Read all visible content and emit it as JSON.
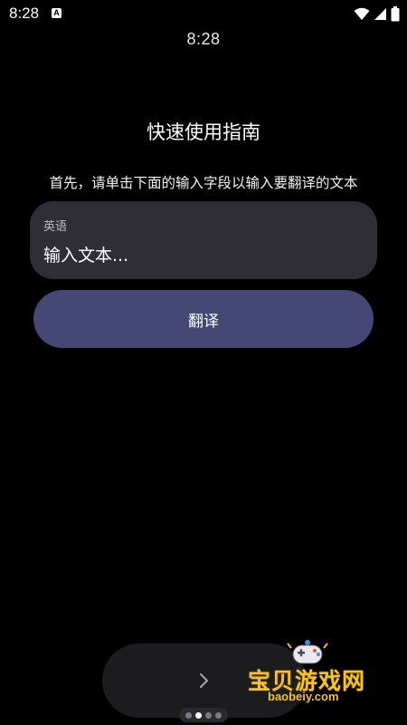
{
  "status_bar": {
    "time": "8:28",
    "notification_icon": "a-letter-icon",
    "icons": [
      "wifi-icon",
      "signal-icon",
      "battery-icon"
    ]
  },
  "clock": {
    "time": "8:28"
  },
  "guide": {
    "title": "快速使用指南",
    "instruction": "首先，请单击下面的输入字段以输入要翻译的文本"
  },
  "input": {
    "language_label": "英语",
    "placeholder": "输入文本..."
  },
  "translate_button": {
    "label": "翻译"
  },
  "pager": {
    "next_icon": "chevron-right-icon",
    "total_pages": 4,
    "current_page": 2
  },
  "watermark": {
    "text": "宝贝游戏网",
    "url": "baobeiy.com"
  },
  "colors": {
    "background": "#000000",
    "input_card": "#2f2d36",
    "button": "#454874",
    "watermark": "#f2c230"
  }
}
